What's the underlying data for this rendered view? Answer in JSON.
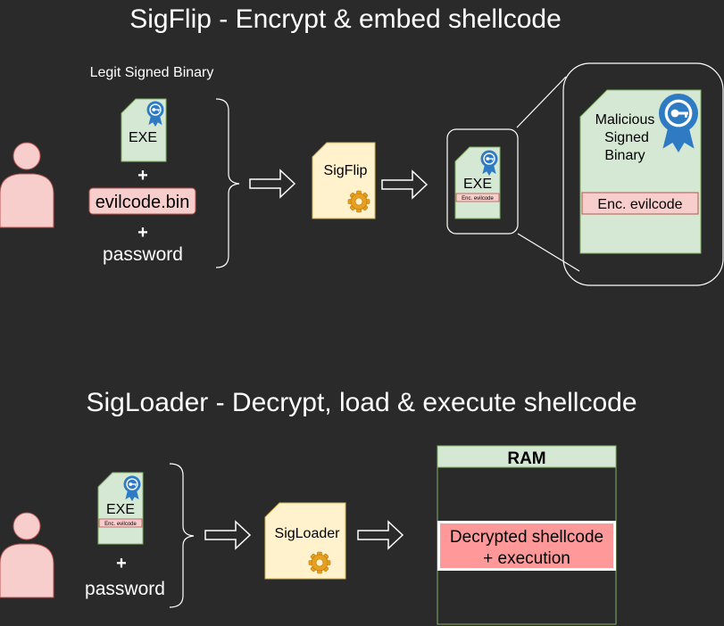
{
  "colors": {
    "background": "#2a2a2a",
    "file_fill": "#d5e8d4",
    "tool_fill": "#fff2cc",
    "person_fill": "#f8cecc",
    "enc_fill": "#f8cecc",
    "shellcode_fill": "#ff9999",
    "badge_blue": "#2e7bc4",
    "gear_orange": "#e8a020",
    "outline": "#ffffff"
  },
  "section1": {
    "title": "SigFlip - Encrypt & embed shellcode",
    "legit_label": "Legit Signed Binary",
    "exe_label": "EXE",
    "plus1": "+",
    "payload_label": "evilcode.bin",
    "plus2": "+",
    "password_label": "password",
    "tool_label": "SigFlip",
    "out_exe_label": "EXE",
    "out_enc_label": "Enc. evilcode",
    "zoom_label_line1": "Malicious",
    "zoom_label_line2": "Signed",
    "zoom_label_line3": "Binary",
    "zoom_enc_label": "Enc. evilcode"
  },
  "section2": {
    "title": "SigLoader - Decrypt, load & execute shellcode",
    "exe_label": "EXE",
    "enc_label": "Enc. evilcode",
    "plus": "+",
    "password_label": "password",
    "tool_label": "SigLoader",
    "ram_label": "RAM",
    "shellcode_line1": "Decrypted shellcode",
    "shellcode_line2": "+ execution"
  },
  "icons": {
    "badge": "certificate-badge-icon",
    "gear": "gear-icon",
    "person": "person-icon",
    "arrow": "right-arrow-icon"
  }
}
